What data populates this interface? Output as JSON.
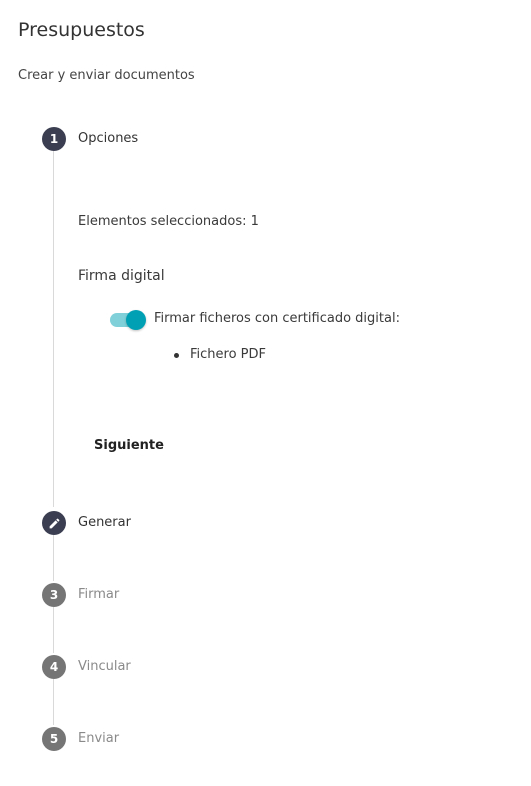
{
  "header": {
    "title": "Presupuestos",
    "subtitle": "Crear y enviar documentos"
  },
  "steps": [
    {
      "number": "1",
      "label": "Opciones",
      "state": "active",
      "icon": "number"
    },
    {
      "number": "",
      "label": "Generar",
      "state": "active",
      "icon": "pencil-icon"
    },
    {
      "number": "3",
      "label": "Firmar",
      "state": "pending",
      "icon": "number"
    },
    {
      "number": "4",
      "label": "Vincular",
      "state": "pending",
      "icon": "number"
    },
    {
      "number": "5",
      "label": "Enviar",
      "state": "pending",
      "icon": "number"
    }
  ],
  "options": {
    "selected_count_text": "Elementos seleccionados: 1",
    "digital_signature_title": "Firma digital",
    "sign_toggle": {
      "label": "Firmar ficheros con certificado digital:",
      "checked": true
    },
    "files": [
      "Fichero PDF"
    ],
    "next_label": "Siguiente"
  },
  "colors": {
    "step_active": "#3b3e51",
    "step_pending": "#757575",
    "toggle_track": "#7fd0d9",
    "toggle_thumb": "#00a0b4"
  }
}
